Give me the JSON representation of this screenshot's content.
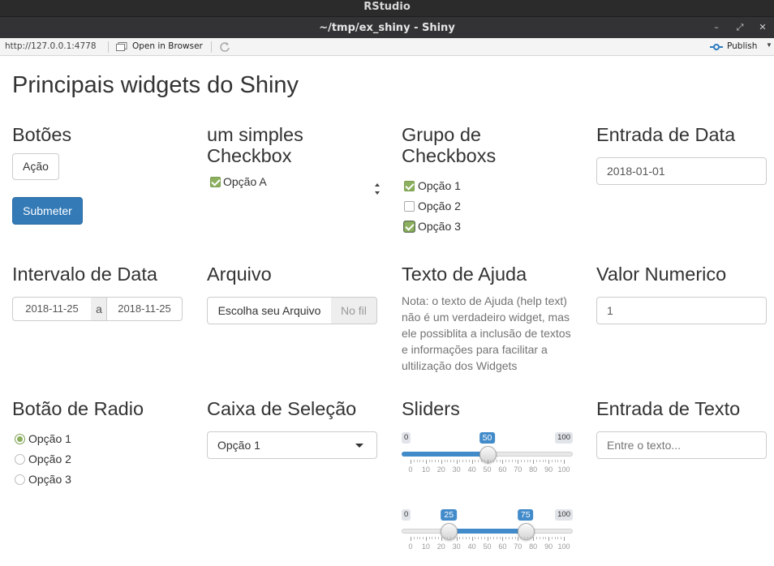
{
  "window": {
    "app_title": "RStudio",
    "title": "~/tmp/ex_shiny - Shiny",
    "controls": [
      "–",
      "⤢",
      "✕"
    ]
  },
  "toolbar": {
    "url": "http://127.0.0.1:4778",
    "open_in_browser_label": "Open in Browser",
    "publish_label": "Publish"
  },
  "page": {
    "title": "Principais widgets do Shiny"
  },
  "botoes": {
    "heading": "Botões",
    "action_label": "Ação",
    "submit_label": "Submeter"
  },
  "checkbox": {
    "heading_line1": "um simples",
    "heading_line2": "Checkbox",
    "label": "Opção A",
    "checked": true
  },
  "checkbox_group": {
    "heading_line1": "Grupo de",
    "heading_line2": "Checkboxs",
    "options": [
      {
        "label": "Opção 1",
        "checked": true
      },
      {
        "label": "Opção 2",
        "checked": false
      },
      {
        "label": "Opção 3",
        "checked": true
      }
    ]
  },
  "date_input": {
    "heading": "Entrada de Data",
    "value": "2018-01-01"
  },
  "date_range": {
    "heading": "Intervalo de Data",
    "start": "2018-11-25",
    "separator": "a",
    "end": "2018-11-25"
  },
  "file_input": {
    "heading": "Arquivo",
    "button_label": "Escolha seu Arquivo",
    "status": "No fil"
  },
  "help_text": {
    "heading": "Texto de Ajuda",
    "lines": [
      "Nota: o texto de Ajuda (help text)",
      "não é um verdadeiro widget, mas",
      "ele possiblita a inclusão de textos",
      "e informações para facilitar a",
      "ultilização dos Widgets"
    ]
  },
  "numeric_input": {
    "heading": "Valor Numerico",
    "value": "1"
  },
  "radio": {
    "heading": "Botão de Radio",
    "options": [
      {
        "label": "Opção 1",
        "selected": true
      },
      {
        "label": "Opção 2",
        "selected": false
      },
      {
        "label": "Opção 3",
        "selected": false
      }
    ]
  },
  "select": {
    "heading": "Caixa de Seleção",
    "selected": "Opção 1"
  },
  "sliders": {
    "heading": "Sliders",
    "min": 0,
    "max": 100,
    "min_label": "0",
    "max_label": "100",
    "tick_labels": [
      "0",
      "10",
      "20",
      "30",
      "40",
      "50",
      "60",
      "70",
      "80",
      "90",
      "100"
    ],
    "single": {
      "value": 50,
      "label": "50"
    },
    "range": {
      "from": 25,
      "to": 75,
      "from_label": "25",
      "to_label": "75"
    }
  },
  "text_input": {
    "heading": "Entrada de Texto",
    "placeholder": "Entre o texto..."
  },
  "colors": {
    "primary": "#337ab7",
    "slider": "#428bca",
    "checkbox_checked": "#8cb05e"
  }
}
